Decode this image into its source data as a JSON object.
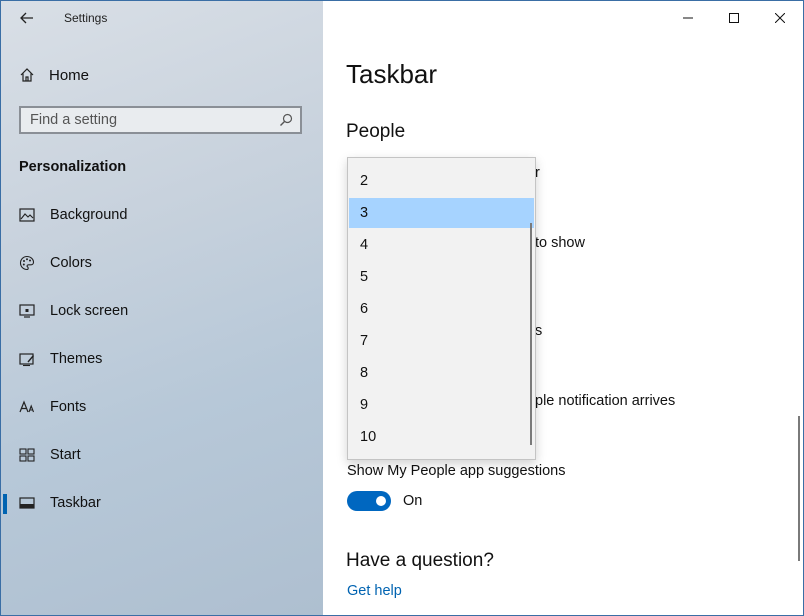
{
  "window": {
    "app_title": "Settings"
  },
  "sidebar": {
    "home_label": "Home",
    "search_placeholder": "Find a setting",
    "section_label": "Personalization",
    "items": [
      {
        "label": "Background",
        "icon": "picture-icon"
      },
      {
        "label": "Colors",
        "icon": "palette-icon"
      },
      {
        "label": "Lock screen",
        "icon": "lock-screen-icon"
      },
      {
        "label": "Themes",
        "icon": "themes-icon"
      },
      {
        "label": "Fonts",
        "icon": "fonts-icon"
      },
      {
        "label": "Start",
        "icon": "start-icon"
      },
      {
        "label": "Taskbar",
        "icon": "taskbar-icon",
        "active": true
      }
    ]
  },
  "content": {
    "page_title": "Taskbar",
    "section_heading": "People",
    "partial_texts": [
      "r",
      "to show",
      "s",
      "ple notification arrives"
    ],
    "app_suggestions_label": "Show My People app suggestions",
    "app_suggestions_state": "On",
    "app_suggestions_on": true,
    "question_heading": "Have a question?",
    "help_link": "Get help"
  },
  "dropdown": {
    "options": [
      "2",
      "3",
      "4",
      "5",
      "6",
      "7",
      "8",
      "9",
      "10"
    ],
    "selected": "3"
  },
  "colors": {
    "accent": "#0067c0",
    "selected_option": "#a6d3ff",
    "link": "#0063b1"
  }
}
